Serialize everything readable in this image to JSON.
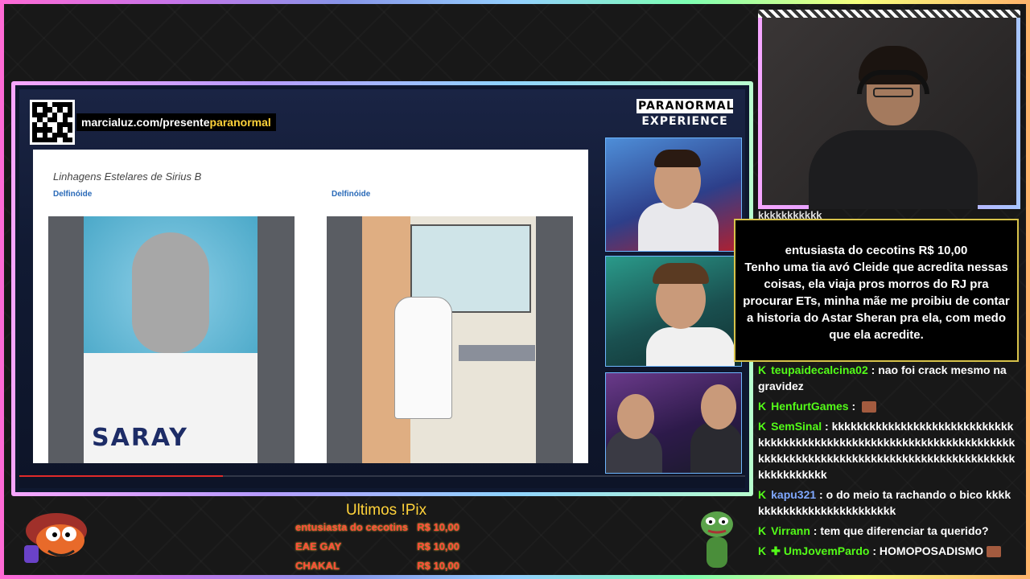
{
  "overlay": {
    "url_prefix": "marcialuz.com/presente",
    "url_highlight": "paranormal",
    "brand_line1": "PARANORMAL",
    "brand_line2": "EXPERIENCE"
  },
  "slide": {
    "title": "Linhagens Estelares de Sirius B",
    "left_label": "Delfinóide",
    "right_label": "Delfinóide",
    "left_art_text": "SARAY"
  },
  "progress": {
    "played_fraction": 0.28
  },
  "chat": {
    "top_line": "kkkkkkkkkkk",
    "donation": {
      "header": "entusiasta do cecotins R$ 10,00",
      "body": "Tenho uma tia avó Cleide que acredita nessas coisas, ela viaja pros morros do RJ pra procurar ETs, minha mãe me proibiu de contar a historia do Astar Sheran pra ela, com medo que ela acredite."
    },
    "messages": [
      {
        "user": "teupaidecalcina02",
        "text": "nao foi crack mesmo na gravidez",
        "color": "green",
        "emote": false
      },
      {
        "user": "HenfurtGames",
        "text": "",
        "color": "green",
        "emote": true
      },
      {
        "user": "SemSinal",
        "text": "kkkkkkkkkkkkkkkkkkkkkkkkkkkkkkkkkkkkkkkkkkkkkkkkkkkkkkkkkkkkkkkkkkkkkkkkkkkkkkkkkkkkkkkkkkkkkkkkkkkkkkkkkkkkkkkkkkkkkkkkkk",
        "color": "green",
        "emote": false
      },
      {
        "user": "kapu321",
        "text": "o do meio ta rachando o bico kkkkkkkkkkkkkkkkkkkkkkkkkk",
        "color": "blue",
        "emote": false
      },
      {
        "user": "Virrann",
        "text": "tem que diferenciar ta querido?",
        "color": "green",
        "emote": false
      },
      {
        "user": "UmJovemPardo",
        "text": "HOMOPOSADISMO",
        "color": "green",
        "emote": true
      }
    ]
  },
  "pix": {
    "title": "Ultimos !Pix",
    "entries": [
      {
        "name": "entusiasta do cecotins",
        "amount": "R$ 10,00"
      },
      {
        "name": "EAE GAY",
        "amount": "R$ 10,00"
      },
      {
        "name": "CHAKAL",
        "amount": "R$ 10,00"
      }
    ]
  },
  "colors": {
    "kick_green": "#53fc18",
    "gold": "#ffd23a",
    "pix_red": "#ff4a3a"
  }
}
